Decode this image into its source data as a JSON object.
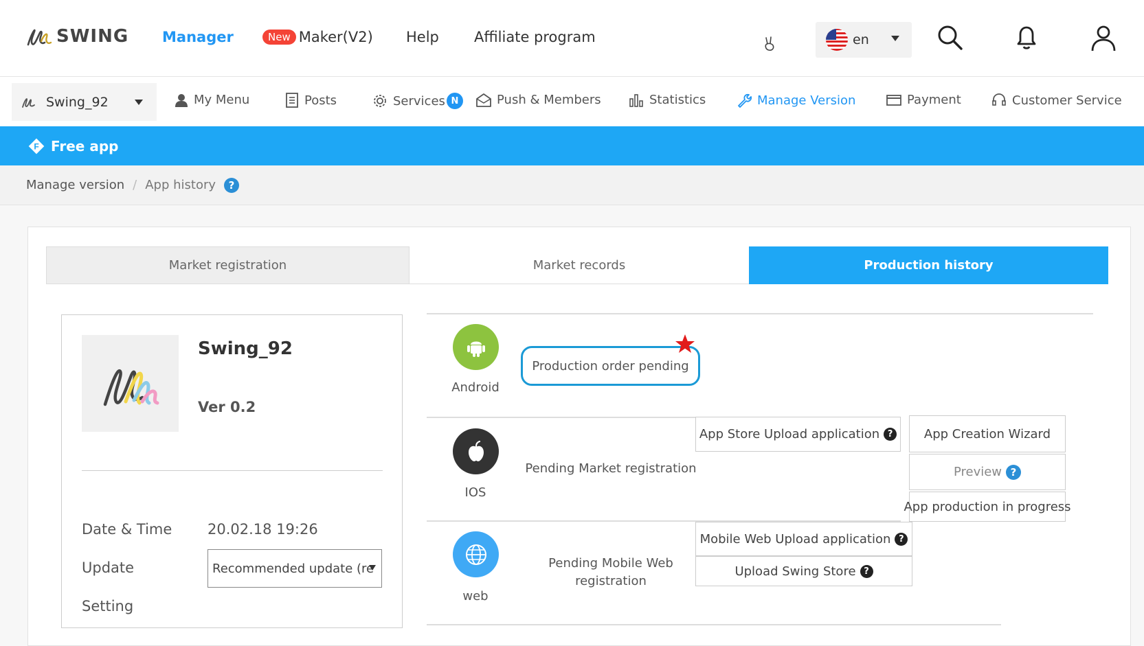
{
  "header": {
    "brand": "SWING",
    "nav": {
      "manager": "Manager",
      "new_badge": "New",
      "maker": "Maker(V2)",
      "help": "Help",
      "affiliate": "Affiliate program"
    },
    "language": "en"
  },
  "subnav": {
    "app_name": "Swing_92",
    "items": {
      "my_menu": "My Menu",
      "posts": "Posts",
      "services": "Services",
      "services_badge": "N",
      "push_members": "Push & Members",
      "statistics": "Statistics",
      "manage_version": "Manage Version",
      "payment": "Payment",
      "customer_service": "Customer Service"
    }
  },
  "plan": {
    "badge": "F",
    "label": "Free app"
  },
  "breadcrumb": {
    "root": "Manage version",
    "separator": "/",
    "current": "App history"
  },
  "tabs": {
    "market_registration": "Market registration",
    "market_records": "Market records",
    "production_history": "Production history"
  },
  "app_card": {
    "name": "Swing_92",
    "version": "Ver 0.2",
    "date_label": "Date & Time",
    "date_value": "20.02.18 19:26",
    "update_label": "Update",
    "update_value": "Recommended update (re",
    "setting_label": "Setting"
  },
  "platforms": {
    "android": {
      "label": "Android",
      "status": "Production order pending"
    },
    "ios": {
      "label": "IOS",
      "status": "Pending Market registration",
      "upload_button": "App Store Upload application",
      "wizard_button": "App Creation Wizard",
      "preview_button": "Preview",
      "progress_button": "App production in progress"
    },
    "web": {
      "label": "web",
      "status_line1": "Pending Mobile Web",
      "status_line2": "registration",
      "upload_button": "Mobile Web Upload application",
      "store_button": "Upload Swing Store"
    }
  },
  "colors": {
    "accent": "#1ea7f5",
    "android": "#8dc33f",
    "ios": "#333333",
    "web": "#3fa9f5",
    "star": "#e21b1b"
  }
}
